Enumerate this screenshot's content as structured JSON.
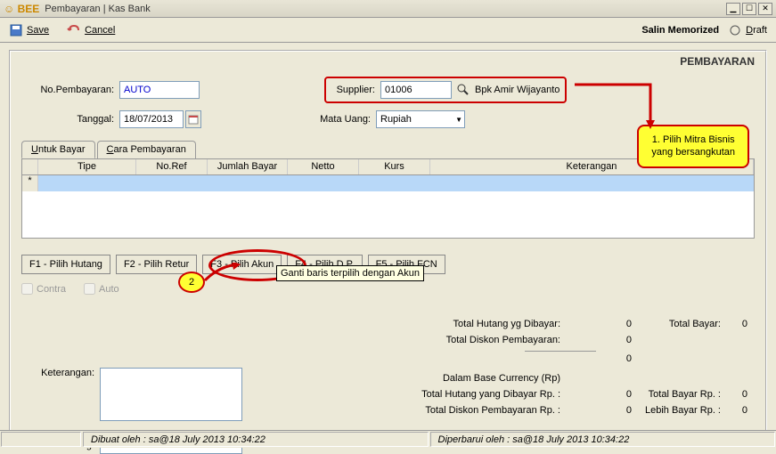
{
  "window": {
    "app": "Bee",
    "title": "Pembayaran | Kas Bank"
  },
  "toolbar": {
    "save": "Save",
    "cancel": "Cancel",
    "salin": "Salin Memorized",
    "draft": "Draft"
  },
  "panel": {
    "title": "PEMBAYARAN"
  },
  "form": {
    "no_label": "No.Pembayaran:",
    "no_value": "AUTO",
    "tanggal_label": "Tanggal:",
    "tanggal_value": "18/07/2013",
    "supplier_label": "Supplier:",
    "supplier_code": "01006",
    "supplier_name": "Bpk Amir Wijayanto",
    "matauang_label": "Mata Uang:",
    "matauang_value": "Rupiah"
  },
  "tabs": {
    "untuk": "Untuk Bayar",
    "cara": "Cara Pembayaran"
  },
  "grid": {
    "headers": {
      "tipe": "Tipe",
      "noref": "No.Ref",
      "jumlah": "Jumlah Bayar",
      "netto": "Netto",
      "kurs": "Kurs",
      "ket": "Keterangan"
    }
  },
  "buttons": {
    "f1": "F1 - Pilih Hutang",
    "f2": "F2 - Pilih Retur",
    "f3": "F3 - Pilih Akun",
    "f4": "F4 - Pilih D.P.",
    "f5": "F5 - Pilih FCN"
  },
  "checks": {
    "contra": "Contra",
    "auto": "Auto"
  },
  "tooltip": "Ganti baris terpilih dengan Akun",
  "callouts": {
    "c1_line1": "1. Pilih Mitra Bisnis",
    "c1_line2": "yang bersangkutan",
    "c2": "2"
  },
  "totals": {
    "hutang_dibayar_lbl": "Total Hutang yg Dibayar:",
    "hutang_dibayar_val": "0",
    "diskon_lbl": "Total Diskon Pembayaran:",
    "diskon_val": "0",
    "sum_val": "0",
    "total_bayar_lbl": "Total Bayar:",
    "total_bayar_val": "0",
    "base_lbl": "Dalam Base Currency (Rp)",
    "hutang_rp_lbl": "Total Hutang yang Dibayar Rp. :",
    "hutang_rp_val": "0",
    "diskon_rp_lbl": "Total Diskon Pembayaran Rp. :",
    "diskon_rp_val": "0",
    "total_bayar_rp_lbl": "Total Bayar Rp. :",
    "total_bayar_rp_val": "0",
    "lebih_rp_lbl": "Lebih Bayar Rp. :",
    "lebih_rp_val": "0"
  },
  "keterangan": {
    "label": "Keterangan:"
  },
  "cabang": {
    "label": "Cabang:"
  },
  "status": {
    "dibuat": "Dibuat oleh : sa@18 July 2013  10:34:22",
    "diperbarui": "Diperbarui oleh : sa@18 July 2013  10:34:22"
  }
}
